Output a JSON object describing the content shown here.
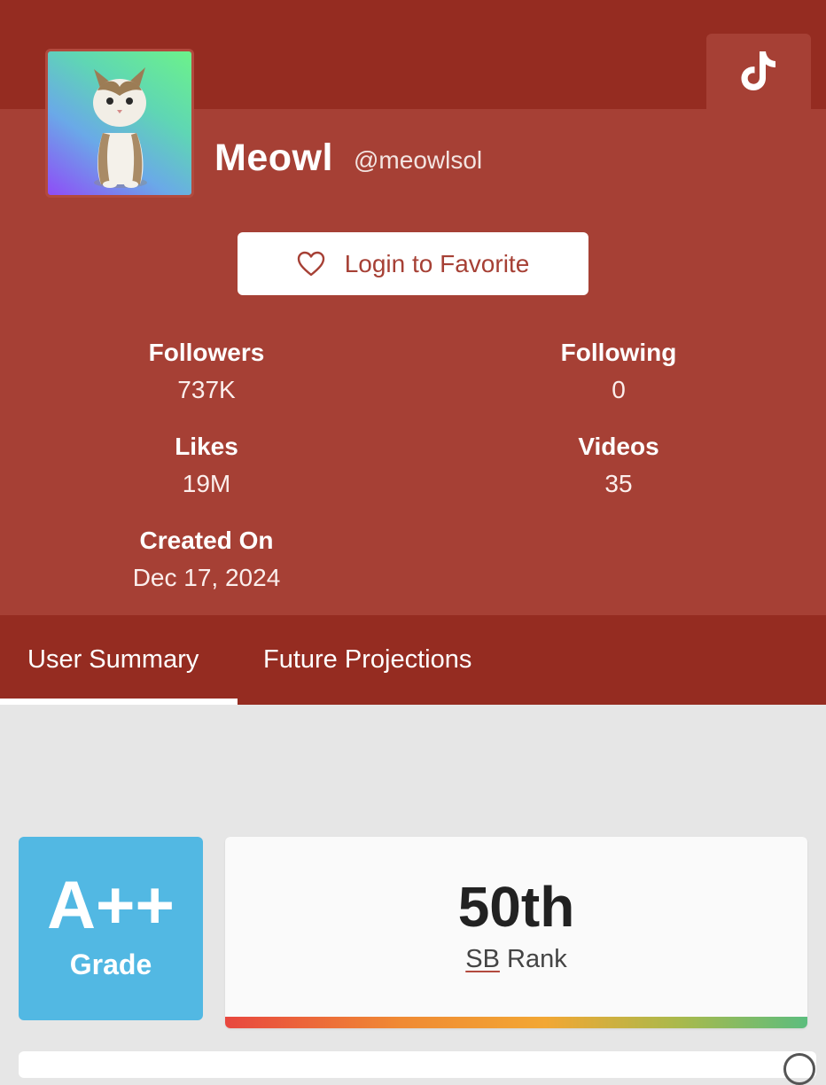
{
  "profile": {
    "display_name": "Meowl",
    "handle": "@meowlsol",
    "avatar_icon": "cat-avatar",
    "platform_icon": "tiktok-icon"
  },
  "favorite_button": {
    "label": "Login to Favorite",
    "icon": "heart-icon"
  },
  "stats": {
    "followers": {
      "label": "Followers",
      "value": "737K"
    },
    "following": {
      "label": "Following",
      "value": "0"
    },
    "likes": {
      "label": "Likes",
      "value": "19M"
    },
    "videos": {
      "label": "Videos",
      "value": "35"
    },
    "created": {
      "label": "Created On",
      "value": "Dec 17, 2024"
    }
  },
  "tabs": [
    {
      "label": "User Summary",
      "active": true
    },
    {
      "label": "Future Projections",
      "active": false
    }
  ],
  "grade": {
    "value": "A++",
    "caption": "Grade"
  },
  "rank": {
    "value": "50th",
    "abbr": "SB",
    "caption": "Rank"
  },
  "colors": {
    "header": "#952c21",
    "panel": "#a64035",
    "grade_card": "#52b8e3",
    "page_background": "#e6e6e6"
  }
}
